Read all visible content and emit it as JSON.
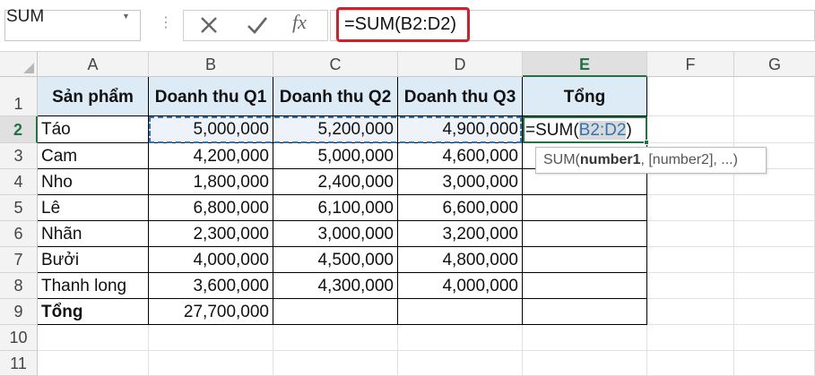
{
  "name_box": {
    "value": "SUM"
  },
  "formula_bar": {
    "cancel_icon": "cancel-x-icon",
    "enter_icon": "checkmark-icon",
    "fx_label": "fx",
    "formula": "=SUM(B2:D2)"
  },
  "columns": [
    "A",
    "B",
    "C",
    "D",
    "E",
    "F",
    "G"
  ],
  "rows": [
    "1",
    "2",
    "3",
    "4",
    "5",
    "6",
    "7",
    "8",
    "9",
    "10",
    "11"
  ],
  "selected_column": "E",
  "selected_row": "2",
  "table": {
    "headers": [
      "Sản phẩm",
      "Doanh thu Q1",
      "Doanh thu Q2",
      "Doanh thu Q3",
      "Tổng"
    ],
    "rows": [
      [
        "Táo",
        "5,000,000",
        "5,200,000",
        "4,900,000"
      ],
      [
        "Cam",
        "4,200,000",
        "5,000,000",
        "4,600,000"
      ],
      [
        "Nho",
        "1,800,000",
        "2,400,000",
        "3,000,000"
      ],
      [
        "Lê",
        "6,800,000",
        "6,100,000",
        "6,600,000"
      ],
      [
        "Nhãn",
        "2,300,000",
        "3,000,000",
        "3,200,000"
      ],
      [
        "Bưởi",
        "4,000,000",
        "4,500,000",
        "4,800,000"
      ],
      [
        "Thanh long",
        "3,600,000",
        "4,300,000",
        "4,000,000"
      ]
    ],
    "total_label": "Tổng",
    "total_q1": "27,700,000"
  },
  "editing_cell": {
    "prefix": "=SUM(",
    "ref": "B2:D2",
    "suffix": ")"
  },
  "tooltip": {
    "fn": "SUM(",
    "arg1": "number1",
    "rest": ", [number2], ...)"
  },
  "colors": {
    "accent_green": "#217346",
    "header_fill": "#ddebf7",
    "ref_blue": "#2e75b6",
    "highlight_red": "#d0222a"
  }
}
